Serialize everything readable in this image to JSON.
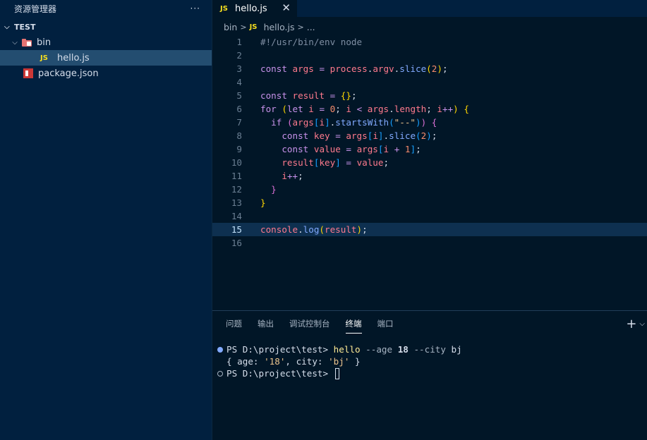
{
  "sidebar": {
    "title": "资源管理器",
    "more_label": "···",
    "section_title": "TEST",
    "tree": {
      "folder_bin": "bin",
      "file_hello": "hello.js",
      "file_package": "package.json"
    }
  },
  "editor": {
    "tab": {
      "label": "hello.js",
      "icon": "JS",
      "close": "✕"
    },
    "breadcrumb": {
      "folder": "bin",
      "icon": "JS",
      "file": "hello.js",
      "tail": "..."
    },
    "current_line": 15,
    "lines": [
      "#!/usr/bin/env node",
      "",
      "const args = process.argv.slice(2);",
      "",
      "const result = {};",
      "for (let i = 0; i < args.length; i++) {",
      "  if (args[i].startsWith(\"--\")) {",
      "    const key = args[i].slice(2);",
      "    const value = args[i + 1];",
      "    result[key] = value;",
      "    i++;",
      "  }",
      "}",
      "",
      "console.log(result);",
      ""
    ]
  },
  "panel": {
    "tabs": [
      "问题",
      "输出",
      "调试控制台",
      "终端",
      "端口"
    ],
    "active_tab": "终端",
    "terminal": {
      "prompt": "PS D:\\project\\test> ",
      "command": "hello",
      "args": [
        "--age",
        "18",
        "--city",
        "bj"
      ],
      "output": "{ age: '18', city: 'bj' }",
      "output_parts": {
        "open": "{ age: ",
        "v1": "'18'",
        "mid": ", city: ",
        "v2": "'bj'",
        "close": " }"
      }
    }
  },
  "colors": {
    "background": "#011627",
    "sidebar": "#01203f",
    "selection": "#234d70",
    "keyword": "#c792ea",
    "variable": "#ff7a8d",
    "function": "#82aaff",
    "number": "#f78c6c"
  }
}
